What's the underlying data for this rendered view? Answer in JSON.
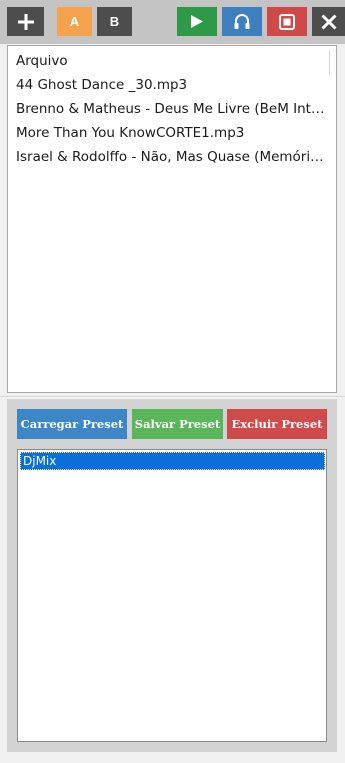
{
  "toolbar": {
    "buttons": [
      {
        "id": "add",
        "icon": "plus-icon",
        "color": "#4d4d4d"
      },
      {
        "id": "deck_a",
        "label": "A",
        "color": "#f5a24c"
      },
      {
        "id": "deck_b",
        "label": "B",
        "color": "#4d4d4d"
      },
      {
        "id": "play",
        "icon": "play-icon",
        "color": "#2e9a48"
      },
      {
        "id": "headphones",
        "icon": "headphones-icon",
        "color": "#3f7fbf"
      },
      {
        "id": "stop",
        "icon": "stop-icon",
        "color": "#d04848"
      },
      {
        "id": "close",
        "icon": "close-icon",
        "color": "#4d4d4d"
      }
    ]
  },
  "file_list": {
    "header": "Arquivo",
    "items": [
      "44 Ghost Dance _30.mp3",
      "Brenno & Matheus - Deus Me Livre (BeM Inter…",
      "More Than You KnowCORTE1.mp3",
      "Israel & Rodolffo - Não, Mas Quase (Memória…"
    ]
  },
  "presets": {
    "load_label": "Carregar Preset",
    "save_label": "Salvar Preset",
    "delete_label": "Excluir Preset",
    "items": [
      "DjMix"
    ],
    "selected": "DjMix",
    "selection_color": "#0a6fd6"
  }
}
